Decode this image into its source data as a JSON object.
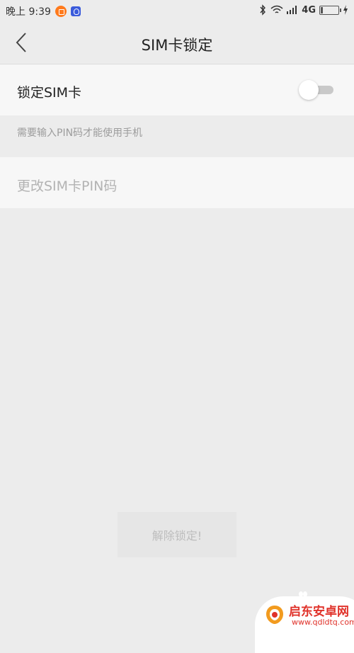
{
  "status_bar": {
    "time": "晚上 9:39",
    "network": "4G",
    "app_icons": [
      "orange-app-icon",
      "shield-app-icon"
    ],
    "right_icons": [
      "bluetooth-icon",
      "wifi-icon",
      "signal-icon",
      "battery-icon",
      "charging-icon"
    ]
  },
  "header": {
    "title": "SIM卡锁定",
    "back_icon": "chevron-left-icon"
  },
  "lock_row": {
    "label": "锁定SIM卡",
    "toggle_on": false
  },
  "hint": "需要输入PIN码才能使用手机",
  "change_row": {
    "label": "更改SIM卡PIN码",
    "enabled": false
  },
  "unlock_button": {
    "label": "解除锁定!",
    "enabled": false
  },
  "watermark": {
    "name": "启东安卓网",
    "url": "www.qdldtq.com"
  },
  "colors": {
    "background": "#ececec",
    "row_background": "#f7f7f7",
    "watermark_red": "#e0322a"
  }
}
